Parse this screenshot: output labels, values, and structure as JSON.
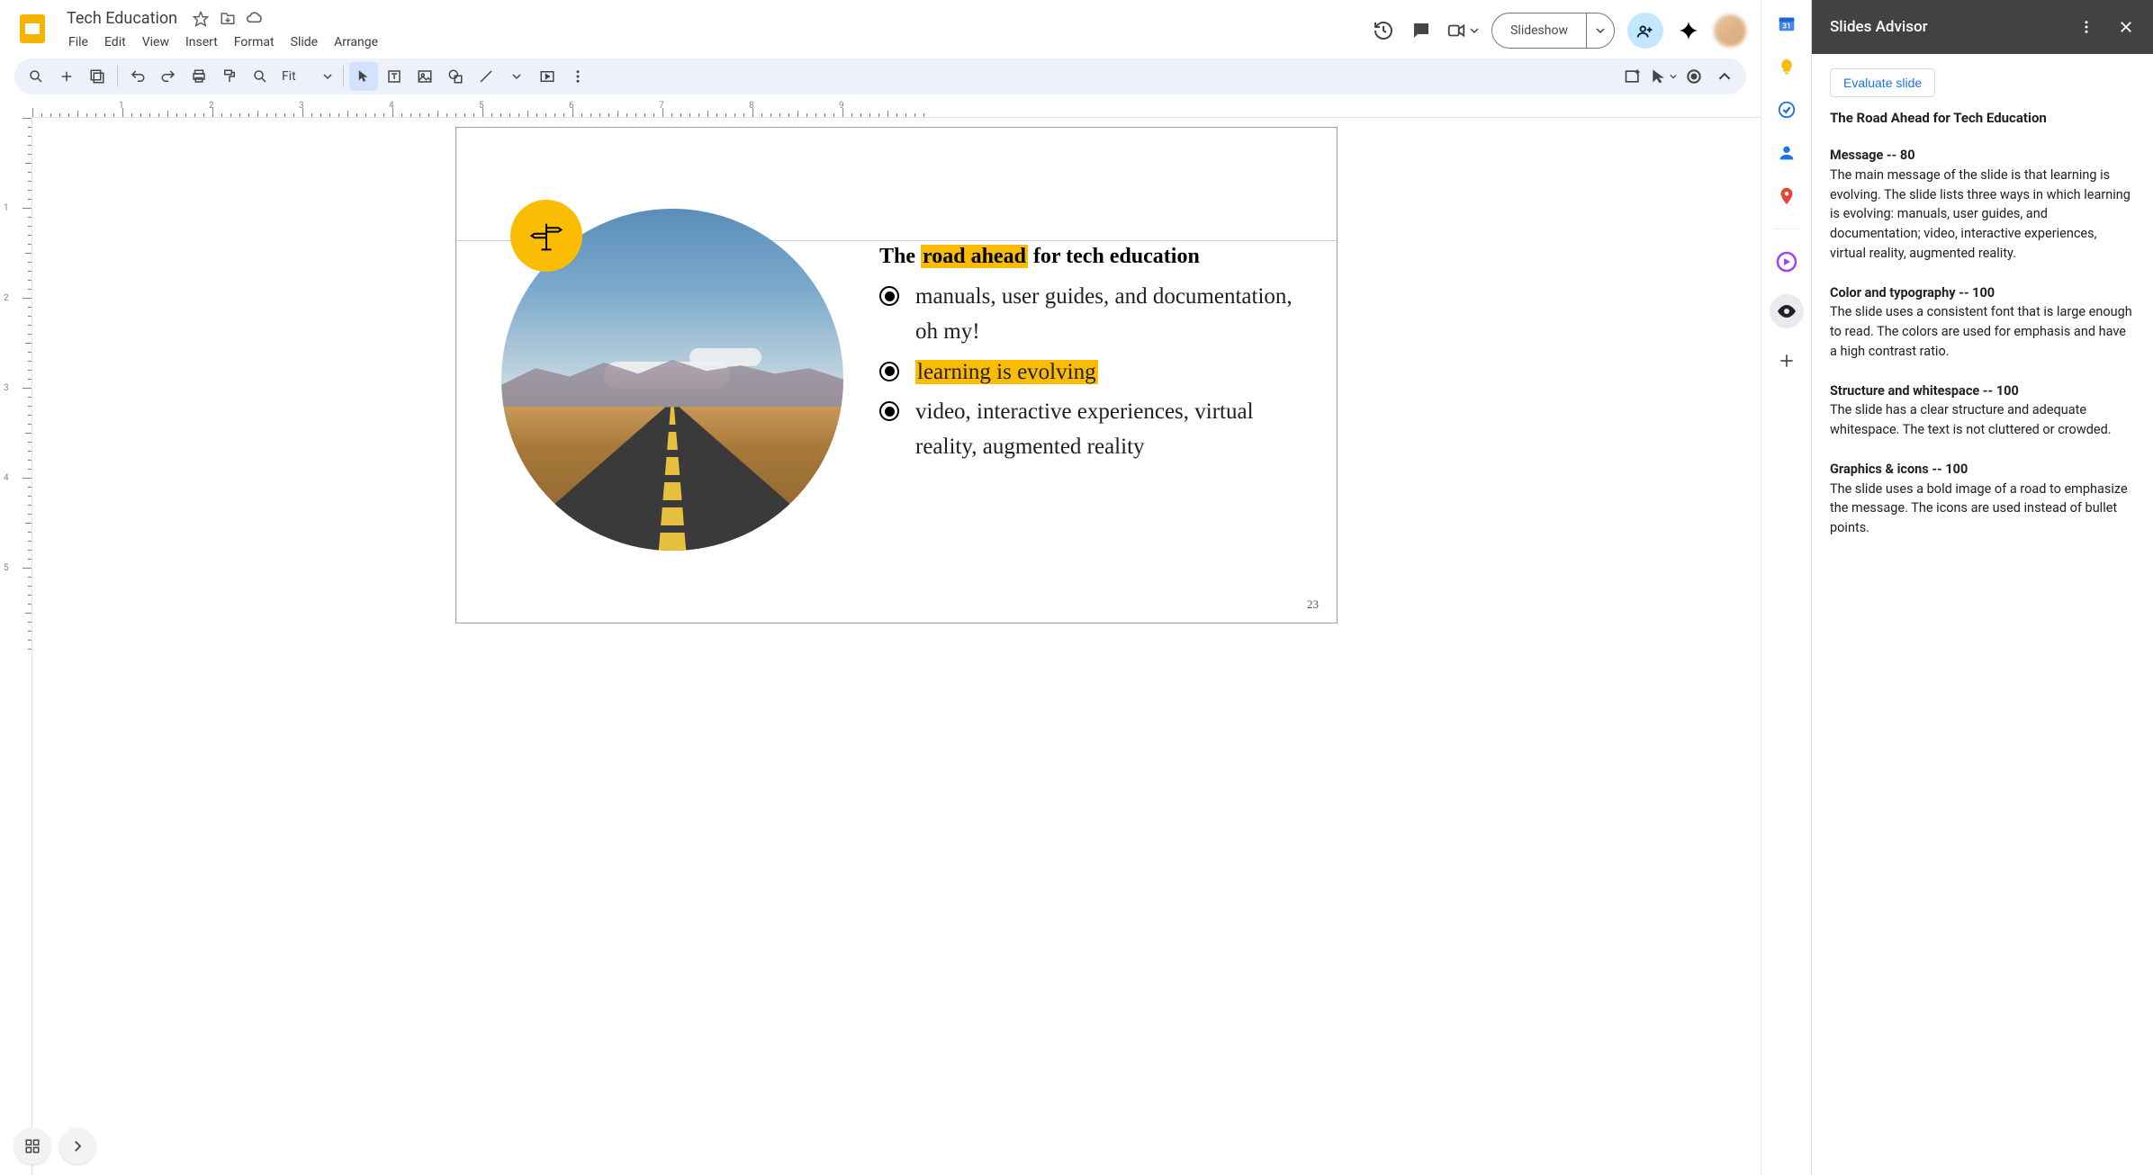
{
  "document": {
    "title": "Tech Education"
  },
  "menu": {
    "file": "File",
    "edit": "Edit",
    "view": "View",
    "insert": "Insert",
    "format": "Format",
    "slide": "Slide",
    "arrange": "Arrange"
  },
  "header": {
    "slideshow": "Slideshow"
  },
  "toolbar": {
    "zoom": "Fit"
  },
  "ruler": {
    "h": [
      "1",
      "2",
      "3",
      "4",
      "5",
      "6",
      "7",
      "8",
      "9"
    ],
    "v": [
      "1",
      "2",
      "3",
      "4",
      "5"
    ]
  },
  "slide": {
    "title_pre": "The ",
    "title_hl": "road ahead",
    "title_post": " for tech education",
    "bullets": {
      "b1": "manuals, user guides, and documentation, oh my!",
      "b2_hl": "learning is evolving",
      "b3": "video, interactive experiences, virtual reality, augmented reality"
    },
    "page_number": "23"
  },
  "advisor": {
    "title": "Slides Advisor",
    "evaluate": "Evaluate slide",
    "slide_title": "The Road Ahead for Tech Education",
    "sections": {
      "s1": {
        "title": "Message -- 80",
        "body": "The main message of the slide is that learning is evolving. The slide lists three ways in which learning is evolving: manuals, user guides, and documentation; video, interactive experiences, virtual reality, augmented reality."
      },
      "s2": {
        "title": "Color and typography -- 100",
        "body": "The slide uses a consistent font that is large enough to read. The colors are used for emphasis and have a high contrast ratio."
      },
      "s3": {
        "title": "Structure and whitespace -- 100",
        "body": "The slide has a clear structure and adequate whitespace. The text is not cluttered or crowded."
      },
      "s4": {
        "title": "Graphics & icons -- 100",
        "body": "The slide uses a bold image of a road to emphasize the message. The icons are used instead of bullet points."
      }
    }
  }
}
